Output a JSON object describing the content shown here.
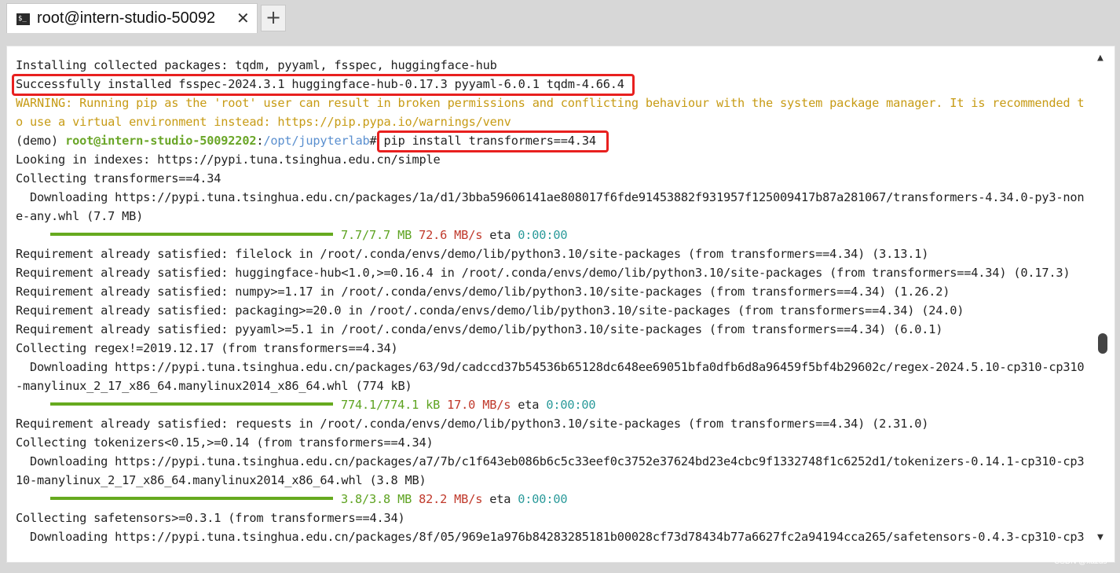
{
  "tab": {
    "icon": "terminal-icon",
    "icon_glyph": "$_",
    "title": "root@intern-studio-50092",
    "close_glyph": "✕"
  },
  "new_tab": {
    "glyph": "+"
  },
  "terminal": {
    "lines": {
      "l0": "Installing collected packages: tqdm, pyyaml, fsspec, huggingface-hub",
      "l1": "Successfully installed fsspec-2024.3.1 huggingface-hub-0.17.3 pyyaml-6.0.1 tqdm-4.66.4",
      "l2": "WARNING: Running pip as the 'root' user can result in broken permissions and conflicting behaviour with the system package manager. It is recommended t",
      "l3": "o use a virtual environment instead: https://pip.pypa.io/warnings/venv",
      "l4_env": "(demo) ",
      "l4_host": "root@intern-studio-50092202",
      "l4_sep": ":",
      "l4_path": "/opt/jupyterlab",
      "l4_dollar": "# ",
      "l4_cmd": "pip install transformers==4.34",
      "l5": "Looking in indexes: https://pypi.tuna.tsinghua.edu.cn/simple",
      "l6": "Collecting transformers==4.34",
      "l7": "  Downloading https://pypi.tuna.tsinghua.edu.cn/packages/1a/d1/3bba59606141ae808017f6fde91453882f931957f125009417b87a281067/transformers-4.34.0-py3-non",
      "l8": "e-any.whl (7.7 MB)",
      "l9_size": "7.7/7.7 MB",
      "l9_speed": "72.6 MB/s",
      "l9_eta_label": "eta",
      "l9_eta": "0:00:00",
      "l10": "Requirement already satisfied: filelock in /root/.conda/envs/demo/lib/python3.10/site-packages (from transformers==4.34) (3.13.1)",
      "l11": "Requirement already satisfied: huggingface-hub<1.0,>=0.16.4 in /root/.conda/envs/demo/lib/python3.10/site-packages (from transformers==4.34) (0.17.3)",
      "l12": "Requirement already satisfied: numpy>=1.17 in /root/.conda/envs/demo/lib/python3.10/site-packages (from transformers==4.34) (1.26.2)",
      "l13": "Requirement already satisfied: packaging>=20.0 in /root/.conda/envs/demo/lib/python3.10/site-packages (from transformers==4.34) (24.0)",
      "l14": "Requirement already satisfied: pyyaml>=5.1 in /root/.conda/envs/demo/lib/python3.10/site-packages (from transformers==4.34) (6.0.1)",
      "l15": "Collecting regex!=2019.12.17 (from transformers==4.34)",
      "l16": "  Downloading https://pypi.tuna.tsinghua.edu.cn/packages/63/9d/cadccd37b54536b65128dc648ee69051bfa0dfb6d8a96459f5bf4b29602c/regex-2024.5.10-cp310-cp310",
      "l17": "-manylinux_2_17_x86_64.manylinux2014_x86_64.whl (774 kB)",
      "l18_size": "774.1/774.1 kB",
      "l18_speed": "17.0 MB/s",
      "l18_eta_label": "eta",
      "l18_eta": "0:00:00",
      "l19": "Requirement already satisfied: requests in /root/.conda/envs/demo/lib/python3.10/site-packages (from transformers==4.34) (2.31.0)",
      "l20": "Collecting tokenizers<0.15,>=0.14 (from transformers==4.34)",
      "l21": "  Downloading https://pypi.tuna.tsinghua.edu.cn/packages/a7/7b/c1f643eb086b6c5c33eef0c3752e37624bd23e4cbc9f1332748f1c6252d1/tokenizers-0.14.1-cp310-cp3",
      "l22": "10-manylinux_2_17_x86_64.manylinux2014_x86_64.whl (3.8 MB)",
      "l23_size": "3.8/3.8 MB",
      "l23_speed": "82.2 MB/s",
      "l23_eta_label": "eta",
      "l23_eta": "0:00:00",
      "l24": "Collecting safetensors>=0.3.1 (from transformers==4.34)",
      "l25": "  Downloading https://pypi.tuna.tsinghua.edu.cn/packages/8f/05/969e1a976b84283285181b00028cf73d78434b77a6627fc2a94194cca265/safetensors-0.4.3-cp310-cp3"
    },
    "progress": {
      "p1": 1.0,
      "p2": 1.0,
      "p3": 1.0
    }
  },
  "scrollbar": {
    "up_glyph": "▲",
    "down_glyph": "▼"
  },
  "colors": {
    "accent_green": "#66aa1f",
    "warning": "#c79b15",
    "highlight": "#e8201f",
    "speed": "#c0392b",
    "eta": "#2a9a9a"
  },
  "watermark": "CSDN @xazds"
}
